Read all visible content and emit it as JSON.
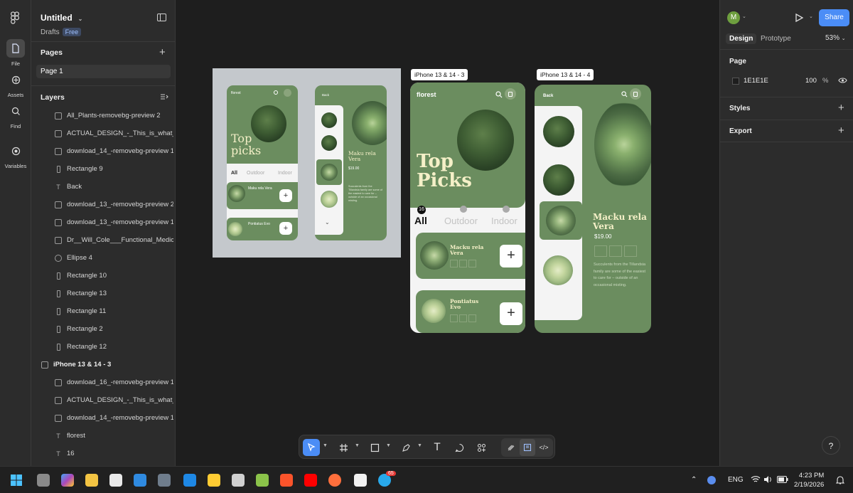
{
  "app": {
    "file_title": "Untitled",
    "drafts_label": "Drafts",
    "plan_badge": "Free"
  },
  "rail": {
    "items": [
      {
        "label": "File",
        "icon": "file-icon"
      },
      {
        "label": "Assets",
        "icon": "assets-icon"
      },
      {
        "label": "Find",
        "icon": "search-icon"
      },
      {
        "label": "Variables",
        "icon": "variables-icon"
      }
    ]
  },
  "pages": {
    "section_label": "Pages",
    "items": [
      "Page 1"
    ]
  },
  "layers": {
    "section_label": "Layers",
    "items": [
      {
        "name": "All_Plants-removebg-preview 2",
        "type": "image"
      },
      {
        "name": "ACTUAL_DESIGN_-_This_is_what_we",
        "type": "image"
      },
      {
        "name": "download_14_-removebg-preview 1",
        "type": "image"
      },
      {
        "name": "Rectangle 9",
        "type": "rectangle"
      },
      {
        "name": "Back",
        "type": "text"
      },
      {
        "name": "download_13_-removebg-preview 2",
        "type": "image"
      },
      {
        "name": "download_13_-removebg-preview 1",
        "type": "image"
      },
      {
        "name": "Dr__Will_Cole___Functional_Medicine_",
        "type": "image"
      },
      {
        "name": "Ellipse 4",
        "type": "ellipse"
      },
      {
        "name": "Rectangle 10",
        "type": "rectangle"
      },
      {
        "name": "Rectangle 13",
        "type": "rectangle"
      },
      {
        "name": "Rectangle 11",
        "type": "rectangle"
      },
      {
        "name": "Rectangle 2",
        "type": "rectangle"
      },
      {
        "name": "Rectangle 12",
        "type": "rectangle"
      },
      {
        "name": "iPhone 13 & 14 - 3",
        "type": "frame"
      },
      {
        "name": "download_16_-removebg-preview 1",
        "type": "image"
      },
      {
        "name": "ACTUAL_DESIGN_-_This_is_what_we",
        "type": "image"
      },
      {
        "name": "download_14_-removebg-preview 1",
        "type": "image"
      },
      {
        "name": "florest",
        "type": "text"
      },
      {
        "name": "16",
        "type": "text"
      }
    ]
  },
  "canvas": {
    "frame_labels": [
      "iPhone 13 & 14 - 3",
      "iPhone 13 & 14 - 4"
    ],
    "mockup": {
      "brand": "florest",
      "back": "Back",
      "hero": "Top picks",
      "tabs": [
        "All",
        "Outdoor",
        "Indoor"
      ],
      "card1": "Maku rela Vera",
      "card2": "Pontiatus Evo",
      "detail_title": "Maku rela Vera",
      "price": "$19.00",
      "desc": "Succulents from the Tillandsia family are some of the easiest to care for – outside of an occasional misting."
    },
    "frame3": {
      "brand": "florest",
      "hero_line1": "Top",
      "hero_line2": "Picks",
      "count": "16",
      "tabs": [
        "All",
        "Outdoor",
        "Indoor"
      ],
      "card1_title": "Macku rela Vera",
      "card2_title": "Pontiatus Evo",
      "add_symbol": "+"
    },
    "frame4": {
      "back": "Back",
      "title": "Macku rela Vera",
      "price": "$19.00",
      "desc": "Succulents from the Tillandsia family are some of the easiest to care for – outside of an occasional misting."
    }
  },
  "right_panel": {
    "avatar_letter": "M",
    "share_label": "Share",
    "tabs": [
      "Design",
      "Prototype"
    ],
    "zoom": "53%",
    "page_section": "Page",
    "bg_hex": "1E1E1E",
    "bg_opacity": "100",
    "percent": "%",
    "styles_label": "Styles",
    "export_label": "Export",
    "help": "?"
  },
  "taskbar": {
    "lang": "ENG",
    "time": "4:23 PM",
    "date": "2/19/2026",
    "telegram_badge": "65"
  },
  "colors": {
    "accent": "#4b8df6",
    "plant_green": "#6b8d5f",
    "canvas_bg": "#1e1e1e"
  }
}
